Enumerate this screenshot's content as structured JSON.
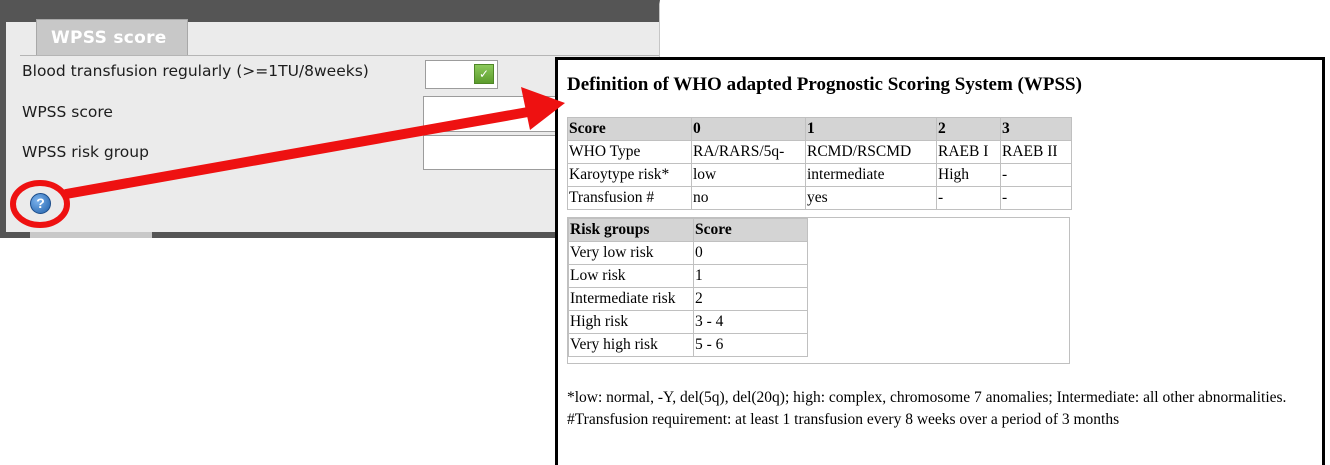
{
  "form": {
    "legend": "WPSS score",
    "rows": [
      {
        "label": "Blood transfusion regularly (>=1TU/8weeks)",
        "value": ""
      },
      {
        "label": "WPSS score",
        "value": ""
      },
      {
        "label": "WPSS risk group",
        "value": ""
      }
    ],
    "select_arrow_glyph": "✓",
    "help_glyph": "?"
  },
  "annotation": {
    "color": "#ee1111"
  },
  "popup": {
    "title": "Definition of WHO adapted Prognostic Scoring System (WPSS)",
    "score_table": {
      "headers": [
        "Score",
        "0",
        "1",
        "2",
        "3"
      ],
      "rows": [
        [
          "WHO Type",
          "RA/RARS/5q-",
          "RCMD/RSCMD",
          "RAEB I",
          "RAEB II"
        ],
        [
          "Karoytype risk*",
          "low",
          "intermediate",
          "High",
          "-"
        ],
        [
          "Transfusion #",
          "no",
          "yes",
          "-",
          "-"
        ]
      ]
    },
    "risk_table": {
      "headers": [
        "Risk groups",
        "Score"
      ],
      "rows": [
        [
          "Very low risk",
          "0"
        ],
        [
          "Low risk",
          "1"
        ],
        [
          "Intermediate risk",
          "2"
        ],
        [
          "High risk",
          "3 - 4"
        ],
        [
          "Very high risk",
          "5 - 6"
        ]
      ]
    },
    "footnote_1": "*low: normal, -Y, del(5q), del(20q); high: complex, chromosome 7 anomalies; Intermediate: all other abnormalities.",
    "footnote_2": "#Transfusion requirement: at least 1 transfusion every 8 weeks over a period of 3 months"
  }
}
